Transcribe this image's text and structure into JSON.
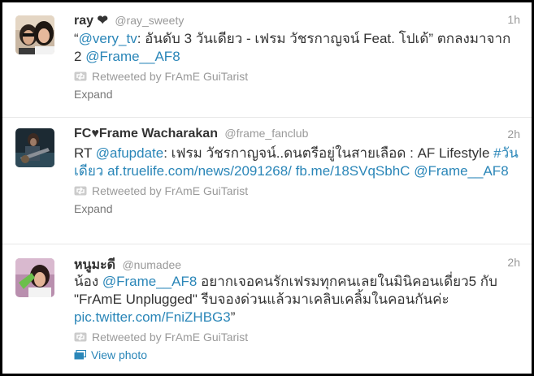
{
  "tweets": [
    {
      "name": "ray ❤",
      "handle": "@ray_sweety",
      "time": "1h",
      "text": [
        {
          "t": "“",
          "link": false
        },
        {
          "t": "@very_tv",
          "link": true
        },
        {
          "t": ": อันดับ 3 วันเดียว - เฟรม วัชรกาญจน์ Feat. โปเด้” ตกลงมาจาก 2 ",
          "link": false
        },
        {
          "t": "@Frame__AF8",
          "link": true
        }
      ],
      "retweeted_by": "Retweeted by FrAmE GuiTarist",
      "action": "Expand"
    },
    {
      "name": "FC♥Frame Wacharakan",
      "handle": "@frame_fanclub",
      "time": "2h",
      "text": [
        {
          "t": "RT ",
          "link": false
        },
        {
          "t": "@afupdate",
          "link": true
        },
        {
          "t": ": เฟรม วัชรกาญจน์..ดนตรีอยู่ในสายเลือด : AF Lifestyle ",
          "link": false
        },
        {
          "t": "#วันเดียว",
          "link": true
        },
        {
          "t": " ",
          "link": false
        },
        {
          "t": "af.truelife.com/news/2091268/",
          "link": true
        },
        {
          "t": " ",
          "link": false
        },
        {
          "t": "fb.me/18SVqSbhC",
          "link": true
        },
        {
          "t": " ",
          "link": false
        },
        {
          "t": "@Frame__AF8",
          "link": true
        }
      ],
      "retweeted_by": "Retweeted by FrAmE GuiTarist",
      "action": "Expand"
    },
    {
      "name": "หนูมะดี",
      "handle": "@numadee",
      "time": "2h",
      "text": [
        {
          "t": "น้อง ",
          "link": false
        },
        {
          "t": "@Frame__AF8",
          "link": true
        },
        {
          "t": " อยากเจอคนรักเฟรมทุกคนเลยในมินิคอนเดี่ยว5 กับ \"FrAmE Unplugged\" รีบจองด่วนแล้วมาเคลิบเคลิ้มในคอนกันค่ะ ",
          "link": false
        },
        {
          "t": "pic.twitter.com/FniZHBG3",
          "link": true
        },
        {
          "t": "”",
          "link": false
        }
      ],
      "retweeted_by": "Retweeted by FrAmE GuiTarist",
      "action": "View photo"
    }
  ],
  "colors": {
    "link": "#2a86b8",
    "muted": "#999999",
    "text": "#333333"
  },
  "icons": {
    "retweet": "retweet-icon",
    "photo": "photo-icon"
  }
}
